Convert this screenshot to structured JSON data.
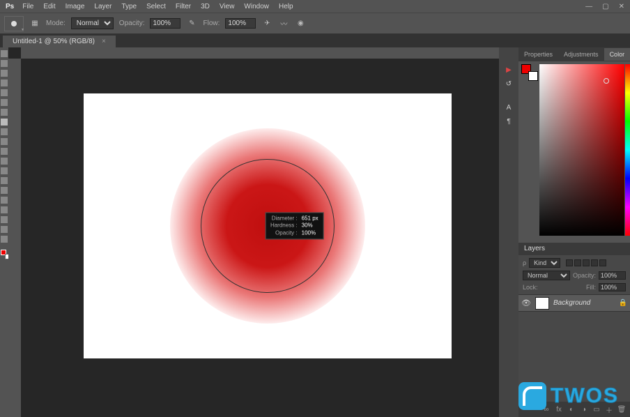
{
  "menu": {
    "items": [
      "File",
      "Edit",
      "Image",
      "Layer",
      "Type",
      "Select",
      "Filter",
      "3D",
      "View",
      "Window",
      "Help"
    ]
  },
  "options": {
    "mode_label": "Mode:",
    "mode_value": "Normal",
    "opacity_label": "Opacity:",
    "opacity_value": "100%",
    "flow_label": "Flow:",
    "flow_value": "100%"
  },
  "tab": {
    "title": "Untitled-1 @ 50% (RGB/8)"
  },
  "brush_tooltip": {
    "diameter_label": "Diameter :",
    "diameter_value": "651 px",
    "hardness_label": "Hardness :",
    "hardness_value": "30%",
    "opacity_label": "Opacity :",
    "opacity_value": "100%"
  },
  "right_panel": {
    "tabs": [
      "Properties",
      "Adjustments",
      "Color"
    ],
    "active_tab": "Color"
  },
  "layers": {
    "header": "Layers",
    "kind_label": "Kind",
    "blend_mode": "Normal",
    "blend_opacity_label": "Opacity:",
    "blend_opacity_value": "100%",
    "lock_label": "Lock:",
    "fill_label": "Fill:",
    "fill_value": "100%",
    "rows": [
      {
        "name": "Background",
        "visible": true,
        "locked": true
      }
    ]
  },
  "watermark": {
    "text": "TWOS"
  },
  "colors": {
    "foreground": "#e00000",
    "background": "#ffffff"
  }
}
